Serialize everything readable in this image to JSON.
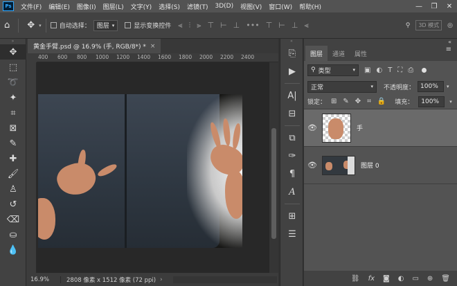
{
  "menubar": {
    "logo": "Ps",
    "items": [
      "文件(F)",
      "编辑(E)",
      "图像(I)",
      "图层(L)",
      "文字(Y)",
      "选择(S)",
      "滤镜(T)",
      "3D(D)",
      "视图(V)",
      "窗口(W)",
      "帮助(H)"
    ],
    "window_buttons": [
      "—",
      "❐",
      "✕"
    ]
  },
  "options": {
    "auto_select_label": "自动选择：",
    "auto_select_value": "图层",
    "show_transform_label": "显示变换控件",
    "mode_label": "3D 模式"
  },
  "document": {
    "tab_title": "黄金手臂.psd @ 16.9% (手, RGB/8*) *",
    "tab_close": "×"
  },
  "ruler": {
    "ticks": [
      "400",
      "600",
      "800",
      "1000",
      "1200",
      "1400",
      "1600",
      "1800",
      "2000",
      "2200",
      "2400"
    ]
  },
  "status": {
    "zoom": "16.9%",
    "info": "2808 像素 x 1512 像素 (72 ppi)",
    "arrow": "›"
  },
  "layers_panel": {
    "tabs": [
      "图层",
      "通道",
      "属性"
    ],
    "active_tab": "图层",
    "filter_label": "类型",
    "blend_mode": "正常",
    "opacity_label": "不透明度：",
    "opacity_value": "100%",
    "lock_label": "锁定：",
    "fill_label": "填充：",
    "fill_value": "100%",
    "layers": [
      {
        "name": "手",
        "visible": true,
        "selected": true
      },
      {
        "name": "图层 0",
        "visible": true,
        "selected": false
      }
    ]
  },
  "colors": {
    "app_bg": "#323232",
    "panel_bg": "#535353",
    "selected_layer": "#6a6a6a",
    "accent": "#31a8ff"
  }
}
